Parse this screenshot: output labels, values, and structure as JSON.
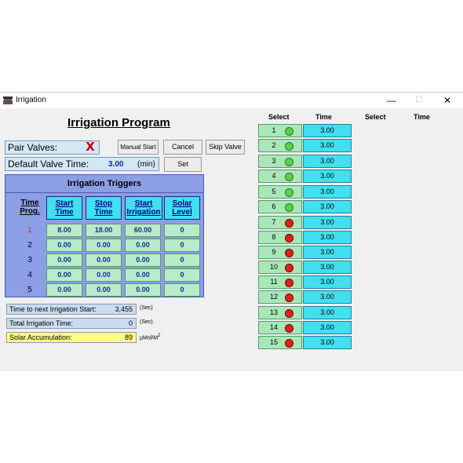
{
  "window": {
    "title": "Irrigation",
    "minimize_glyph": "—",
    "maximize_glyph": "☐",
    "close_glyph": "✕"
  },
  "program": {
    "title": "Irrigation Program",
    "pair_valves_label": "Pair Valves:",
    "pair_valves_state_glyph": "X",
    "default_valve_time_label": "Default Valve Time:",
    "default_valve_time_value": "3.00",
    "default_valve_time_unit": "(min)"
  },
  "buttons": {
    "manual_start": "Manual Start",
    "cancel": "Cancel",
    "skip_valve": "Skip Valve",
    "set": "Set"
  },
  "triggers": {
    "title": "Irrigation Triggers",
    "headers": {
      "time_prog_1": "Time",
      "time_prog_2": "Prog.",
      "start_time_1": "Start",
      "start_time_2": "Time",
      "stop_time_1": "Stop",
      "stop_time_2": "Time",
      "start_irrigation_1": "Start",
      "start_irrigation_2": "Irrigation",
      "solar_level_1": "Solar",
      "solar_level_2": "Level"
    },
    "rows": [
      {
        "prog": "1",
        "start": "8.00",
        "stop": "18.00",
        "irrigation": "60.00",
        "solar": "0"
      },
      {
        "prog": "2",
        "start": "0.00",
        "stop": "0.00",
        "irrigation": "0.00",
        "solar": "0"
      },
      {
        "prog": "3",
        "start": "0.00",
        "stop": "0.00",
        "irrigation": "0.00",
        "solar": "0"
      },
      {
        "prog": "4",
        "start": "0.00",
        "stop": "0.00",
        "irrigation": "0.00",
        "solar": "0"
      },
      {
        "prog": "5",
        "start": "0.00",
        "stop": "0.00",
        "irrigation": "0.00",
        "solar": "0"
      }
    ]
  },
  "status": {
    "next_start_label": "Time to next Irrigation Start:",
    "next_start_value": "3,455",
    "next_start_unit": "(Sec)",
    "total_time_label": "Total Irrigation Time:",
    "total_time_value": "0",
    "total_time_unit": "(Sec)",
    "solar_label": "Solar Accumulation:",
    "solar_value": "89",
    "solar_unit": "µMol/M",
    "solar_unit_sup": "2"
  },
  "valves_header": {
    "select": "Select",
    "time": "Time",
    "select_2": "Select",
    "time_2": "Time"
  },
  "colors": {
    "led_on": "#5ecf48",
    "led_off": "#e0201c",
    "time_cell": "#40e0f0",
    "select_cell": "#a8e8b8"
  },
  "valves": [
    {
      "num": "1",
      "state": "green",
      "time": "3.00"
    },
    {
      "num": "2",
      "state": "green",
      "time": "3.00"
    },
    {
      "num": "3",
      "state": "green",
      "time": "3.00"
    },
    {
      "num": "4",
      "state": "green",
      "time": "3.00"
    },
    {
      "num": "5",
      "state": "green",
      "time": "3.00"
    },
    {
      "num": "6",
      "state": "green",
      "time": "3.00"
    },
    {
      "num": "7",
      "state": "red",
      "time": "3.00"
    },
    {
      "num": "8",
      "state": "red",
      "time": "3.00"
    },
    {
      "num": "9",
      "state": "red",
      "time": "3.00"
    },
    {
      "num": "10",
      "state": "red",
      "time": "3.00"
    },
    {
      "num": "11",
      "state": "red",
      "time": "3.00"
    },
    {
      "num": "12",
      "state": "red",
      "time": "3.00"
    },
    {
      "num": "13",
      "state": "red",
      "time": "3.00"
    },
    {
      "num": "14",
      "state": "red",
      "time": "3.00"
    },
    {
      "num": "15",
      "state": "red",
      "time": "3.00"
    }
  ]
}
